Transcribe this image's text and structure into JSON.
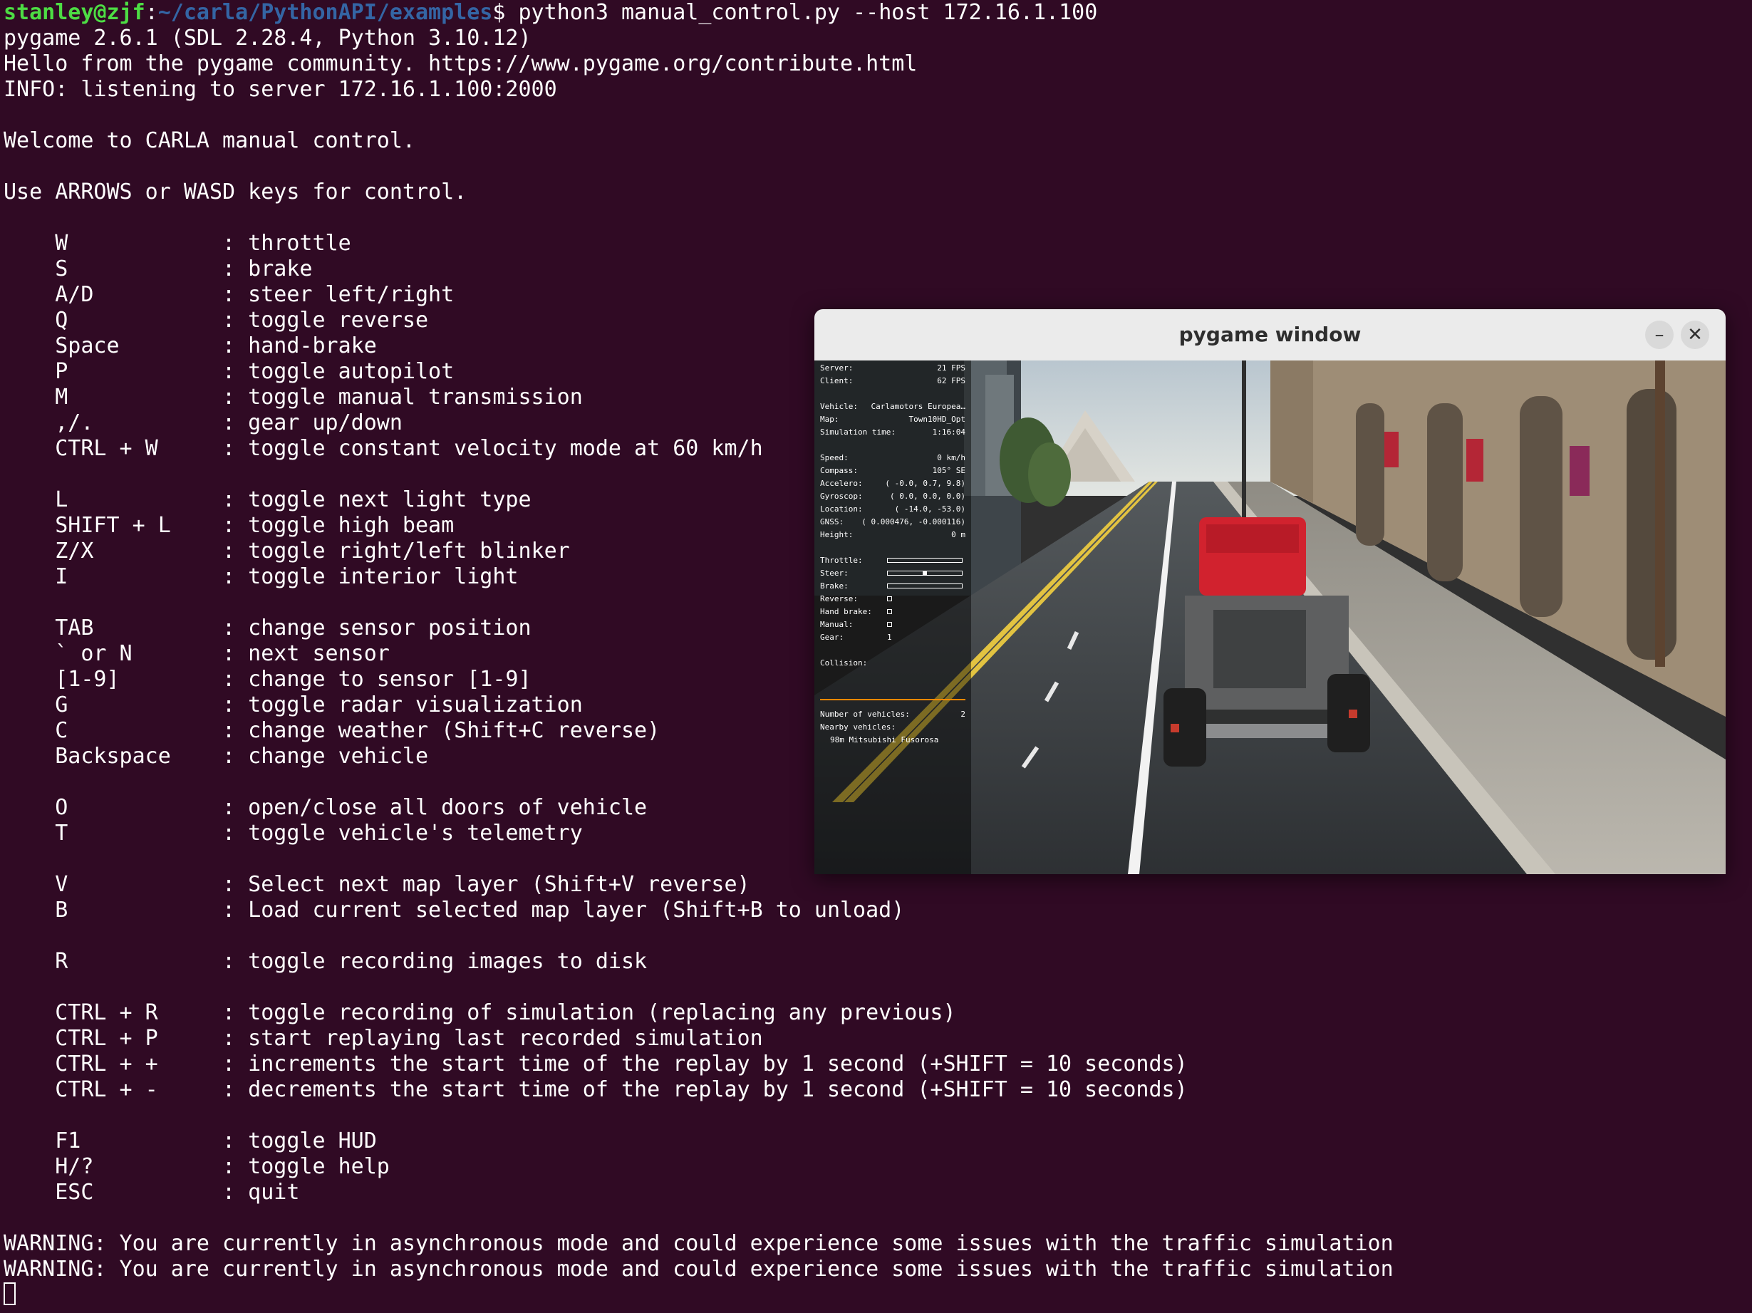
{
  "terminal": {
    "prompt": {
      "user": "stanley@zjf",
      "sep": ":",
      "path": "~/carla/PythonAPI/examples",
      "symbol": "$ ",
      "command": "python3 manual_control.py --host 172.16.1.100"
    },
    "lines": [
      "pygame 2.6.1 (SDL 2.28.4, Python 3.10.12)",
      "Hello from the pygame community. https://www.pygame.org/contribute.html",
      "INFO: listening to server 172.16.1.100:2000",
      "",
      "Welcome to CARLA manual control.",
      "",
      "Use ARROWS or WASD keys for control.",
      "",
      "    W            : throttle",
      "    S            : brake",
      "    A/D          : steer left/right",
      "    Q            : toggle reverse",
      "    Space        : hand-brake",
      "    P            : toggle autopilot",
      "    M            : toggle manual transmission",
      "    ,/.          : gear up/down",
      "    CTRL + W     : toggle constant velocity mode at 60 km/h",
      "",
      "    L            : toggle next light type",
      "    SHIFT + L    : toggle high beam",
      "    Z/X          : toggle right/left blinker",
      "    I            : toggle interior light",
      "",
      "    TAB          : change sensor position",
      "    ` or N       : next sensor",
      "    [1-9]        : change to sensor [1-9]",
      "    G            : toggle radar visualization",
      "    C            : change weather (Shift+C reverse)",
      "    Backspace    : change vehicle",
      "",
      "    O            : open/close all doors of vehicle",
      "    T            : toggle vehicle's telemetry",
      "",
      "    V            : Select next map layer (Shift+V reverse)",
      "    B            : Load current selected map layer (Shift+B to unload)",
      "",
      "    R            : toggle recording images to disk",
      "",
      "    CTRL + R     : toggle recording of simulation (replacing any previous)",
      "    CTRL + P     : start replaying last recorded simulation",
      "    CTRL + +     : increments the start time of the replay by 1 second (+SHIFT = 10 seconds)",
      "    CTRL + -     : decrements the start time of the replay by 1 second (+SHIFT = 10 seconds)",
      "",
      "    F1           : toggle HUD",
      "    H/?          : toggle help",
      "    ESC          : quit",
      "",
      "WARNING: You are currently in asynchronous mode and could experience some issues with the traffic simulation",
      "WARNING: You are currently in asynchronous mode and could experience some issues with the traffic simulation"
    ]
  },
  "pygame_window": {
    "title": "pygame window",
    "minimize_glyph": "–",
    "close_glyph": "✕",
    "hud": {
      "server_label": "Server:",
      "server_value": "21 FPS",
      "client_label": "Client:",
      "client_value": "62 FPS",
      "vehicle_label": "Vehicle:",
      "vehicle_value": "Carlamotors Europea…",
      "map_label": "Map:",
      "map_value": "Town10HD_Opt",
      "simtime_label": "Simulation time:",
      "simtime_value": "1:16:04",
      "speed_label": "Speed:",
      "speed_value": "0 km/h",
      "compass_label": "Compass:",
      "compass_value": "105° SE",
      "accelero_label": "Accelero:",
      "accelero_value": "( -0.0, 0.7, 9.8)",
      "gyroscop_label": "Gyroscop:",
      "gyroscop_value": "( 0.0, 0.0, 0.0)",
      "location_label": "Location:",
      "location_value": "( -14.0, -53.0)",
      "gnss_label": "GNSS:",
      "gnss_value": "( 0.000476, -0.000116)",
      "height_label": "Height:",
      "height_value": "0 m",
      "throttle_label": "Throttle:",
      "throttle_value": 0.0,
      "steer_label": "Steer:",
      "steer_value": 0.0,
      "brake_label": "Brake:",
      "brake_value": 0.0,
      "reverse_label": "Reverse:",
      "handbrake_label": "Hand brake:",
      "manual_label": "Manual:",
      "gear_label": "Gear:",
      "gear_value": "1",
      "collision_label": "Collision:",
      "numveh_label": "Number of vehicles:",
      "numveh_value": "2",
      "nearby_label": "Nearby vehicles:",
      "nearby_item": "98m Mitsubishi Fusorosa"
    }
  },
  "colors": {
    "terminal_bg": "#300a24",
    "prompt_user": "#4ddd44",
    "prompt_path": "#3465a4",
    "hud_accent": "#ff8800"
  }
}
